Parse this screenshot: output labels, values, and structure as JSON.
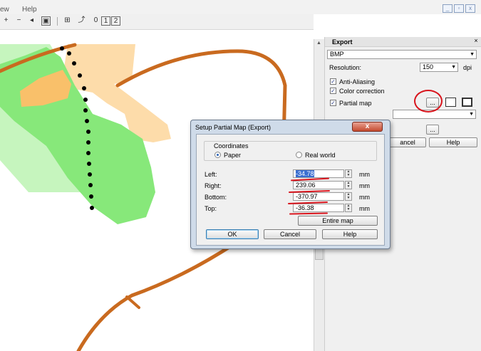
{
  "menubar": {
    "items": [
      "ew",
      "Help"
    ]
  },
  "window_buttons": {
    "minimize": "_",
    "restore": "▫",
    "close": "x"
  },
  "toolbar": {
    "zoom_in": "+",
    "zoom_out": "−",
    "zoom_prev": "◂",
    "zoom_fit": "▣",
    "grid": "⊞",
    "north": "⤴",
    "btn_0": "0",
    "btn_1": "1",
    "btn_2": "2"
  },
  "map": {
    "colors": {
      "light_green": "#c6f5be",
      "green": "#87e87a",
      "peach": "#fddcaa",
      "orange_area": "#f9c06a",
      "track": "#c96a1f",
      "dots": "#000000"
    }
  },
  "export_panel": {
    "title": "Export",
    "close_glyph": "×",
    "format": {
      "value": "BMP"
    },
    "resolution": {
      "label": "Resolution:",
      "value": "150",
      "unit": "dpi"
    },
    "options": [
      {
        "label": "Anti-Aliasing",
        "checked": true
      },
      {
        "label": "Color correction",
        "checked": true
      },
      {
        "label": "Partial map",
        "checked": true
      }
    ],
    "partial_map_button": "...",
    "second_browse_button": "...",
    "cancel_label": "ancel",
    "help_label": "Help"
  },
  "dialog": {
    "title": "Setup Partial Map (Export)",
    "close_glyph": "x",
    "coordinates": {
      "legend": "Coordinates",
      "paper_label": "Paper",
      "real_world_label": "Real world",
      "selected": "Paper"
    },
    "fields": [
      {
        "label": "Left:",
        "value": "-34.78",
        "unit": "mm",
        "selected": true
      },
      {
        "label": "Right:",
        "value": "239.06",
        "unit": "mm",
        "selected": false
      },
      {
        "label": "Bottom:",
        "value": "-370.97",
        "unit": "mm",
        "selected": false
      },
      {
        "label": "Top:",
        "value": "-36.38",
        "unit": "mm",
        "selected": false
      }
    ],
    "entire_map_label": "Entire map",
    "ok_label": "OK",
    "cancel_label": "Cancel",
    "help_label": "Help"
  },
  "annotation": {
    "color": "#d8141c"
  }
}
